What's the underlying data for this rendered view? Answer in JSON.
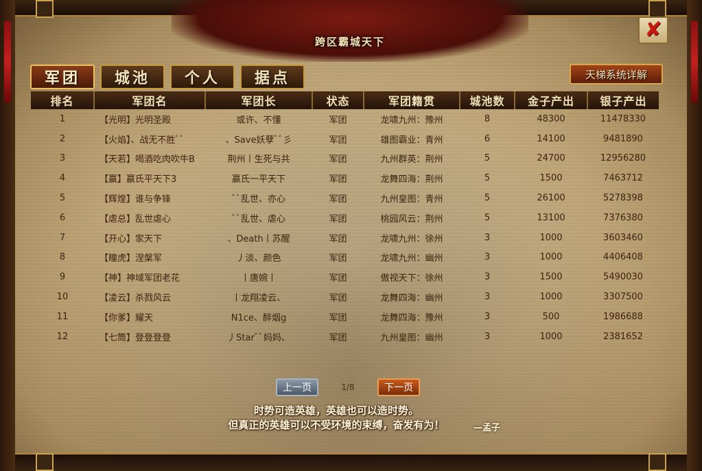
{
  "header": {
    "banner_subtitle": "跨区霸城天下"
  },
  "tabs": [
    {
      "label": "军团",
      "active": true
    },
    {
      "label": "城池",
      "active": false
    },
    {
      "label": "个人",
      "active": false
    },
    {
      "label": "据点",
      "active": false
    }
  ],
  "ladder_button": "天梯系统详解",
  "table": {
    "columns": [
      "排名",
      "军团名",
      "军团长",
      "状态",
      "军团籍贯",
      "城池数",
      "金子产出",
      "银子产出"
    ],
    "rows": [
      [
        "1",
        "【光明】光明圣殿",
        "或许、不懂",
        "军团",
        "龙啸九州：豫州",
        "8",
        "48300",
        "11478330"
      ],
      [
        "2",
        "【火焰】、战无不胜ﾞﾞ",
        "、Save妖孽ﾞﾞ彡",
        "军团",
        "雄图霸业：青州",
        "6",
        "14100",
        "9481890"
      ],
      [
        "3",
        "【天若】喝酒吃肉吹牛B",
        "荆州丨生死与共",
        "军团",
        "九州群英：荆州",
        "5",
        "24700",
        "12956280"
      ],
      [
        "4",
        "【嬴】嬴氏平天下3",
        "嬴氏一平天下",
        "军团",
        "龙舞四海：荆州",
        "5",
        "1500",
        "7463712"
      ],
      [
        "5",
        "【辉煌】谁与争锋",
        "ﾞﾞ乱世、亦心",
        "军团",
        "九州皇图：青州",
        "5",
        "26100",
        "5278398"
      ],
      [
        "6",
        "【虐总】乱世虐心",
        "ﾞﾞ乱世、虐心",
        "军团",
        "桃园风云：荆州",
        "5",
        "13100",
        "7376380"
      ],
      [
        "7",
        "【开心】家天下",
        "、Death丨苏醒",
        "军团",
        "龙啸九州：徐州",
        "3",
        "1000",
        "3603460"
      ],
      [
        "8",
        "【瞳虎】涅槃军",
        "丿淡、颜色",
        "军团",
        "龙啸九州：幽州",
        "3",
        "1000",
        "4406408"
      ],
      [
        "9",
        "【神】神域军团老花",
        "丨唐婉丨",
        "军团",
        "傲视天下：徐州",
        "3",
        "1500",
        "5490030"
      ],
      [
        "10",
        "【凌云】杀戮风云",
        "丨龙翔凌云、",
        "军团",
        "龙舞四海：幽州",
        "3",
        "1000",
        "3307500"
      ],
      [
        "11",
        "【你爹】耀天",
        "N1ce、醉烟g",
        "军团",
        "龙舞四海：豫州",
        "3",
        "500",
        "1986688"
      ],
      [
        "12",
        "【七筒】登登登登",
        "丿Starﾞﾞ妈妈、",
        "军团",
        "九州皇图：幽州",
        "3",
        "1000",
        "2381652"
      ]
    ]
  },
  "pager": {
    "prev_label": "上一页",
    "page_info": "1/8",
    "next_label": "下一页"
  },
  "quote": {
    "line1": "时势可造英雄，英雄也可以造时势。",
    "line2": "但真正的英雄可以不受环境的束缚，奋发有为！",
    "author": "—孟子"
  }
}
